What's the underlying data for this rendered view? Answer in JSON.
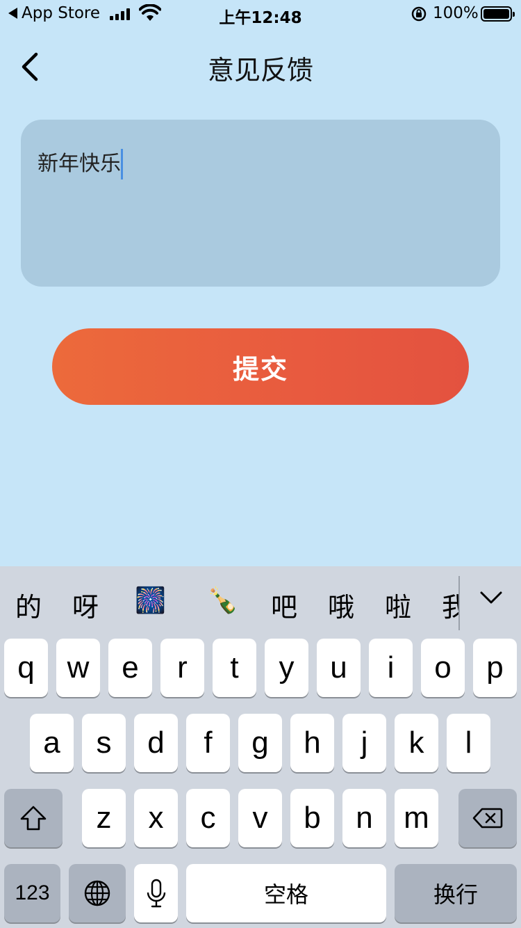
{
  "status_bar": {
    "back_app": "App Store",
    "time": "上午12:48",
    "battery": "100%",
    "icons": [
      "back-triangle-icon",
      "signal-icon",
      "wifi-icon",
      "orientation-lock-icon",
      "battery-icon"
    ]
  },
  "nav": {
    "title": "意见反馈",
    "back_icon": "chevron-left-icon"
  },
  "feedback": {
    "value": "新年快乐"
  },
  "submit": {
    "label": "提交",
    "gradient_start": "#ec6a3b",
    "gradient_end": "#e3523f"
  },
  "keyboard": {
    "candidates": [
      "的",
      "呀",
      "🎆",
      "🍾",
      "吧",
      "哦",
      "啦",
      "我"
    ],
    "row1": [
      "q",
      "w",
      "e",
      "r",
      "t",
      "y",
      "u",
      "i",
      "o",
      "p"
    ],
    "row2": [
      "a",
      "s",
      "d",
      "f",
      "g",
      "h",
      "j",
      "k",
      "l"
    ],
    "row3": [
      "z",
      "x",
      "c",
      "v",
      "b",
      "n",
      "m"
    ],
    "numbers_label": "123",
    "space_label": "空格",
    "return_label": "换行",
    "icons": [
      "shift-icon",
      "delete-icon",
      "globe-icon",
      "mic-icon",
      "chevron-down-icon"
    ]
  }
}
